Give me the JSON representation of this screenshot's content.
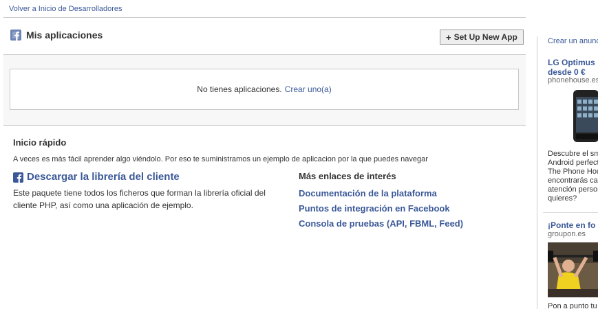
{
  "top": {
    "back_link": "Volver a Inicio de Desarrolladores"
  },
  "header": {
    "title": "Mis aplicaciones",
    "setup_button": "Set Up New App",
    "setup_plus": "+"
  },
  "apps": {
    "empty_text": "No tienes aplicaciones.",
    "create_link": "Crear uno(a)"
  },
  "quick_start": {
    "title": "Inicio rápido",
    "description": "A veces es más fácil aprender algo viéndolo. Por eso te suministramos un ejemplo de aplicacion por la que puedes navegar",
    "download_title": "Descargar la librería del cliente",
    "download_desc": "Este paquete tiene todos los ficheros que forman la librería oficial del cliente PHP, así como una aplicación de ejemplo.",
    "more_links_title": "Más enlaces de interés",
    "more_links": [
      "Documentación de la plataforma",
      "Puntos de integración en Facebook",
      "Consola de pruebas (API, FBML, Feed)"
    ]
  },
  "ads": {
    "create_ad": "Crear un anuncio",
    "items": [
      {
        "title_line1": "LG Optimus",
        "title_line2": "desde 0 €",
        "domain": "phonehouse.es",
        "body": [
          "Descubre el sma",
          "Android perfect",
          "The Phone Hou",
          "encontrarás cal",
          "atención person",
          "quieres?"
        ]
      },
      {
        "title_line1": "¡Ponte en fo",
        "domain": "groupon.es",
        "body": [
          "Pon a punto tu"
        ]
      }
    ]
  },
  "colors": {
    "link": "#3b5998",
    "text": "#333333",
    "border": "#cccccc",
    "band": "#f7f7f7"
  }
}
